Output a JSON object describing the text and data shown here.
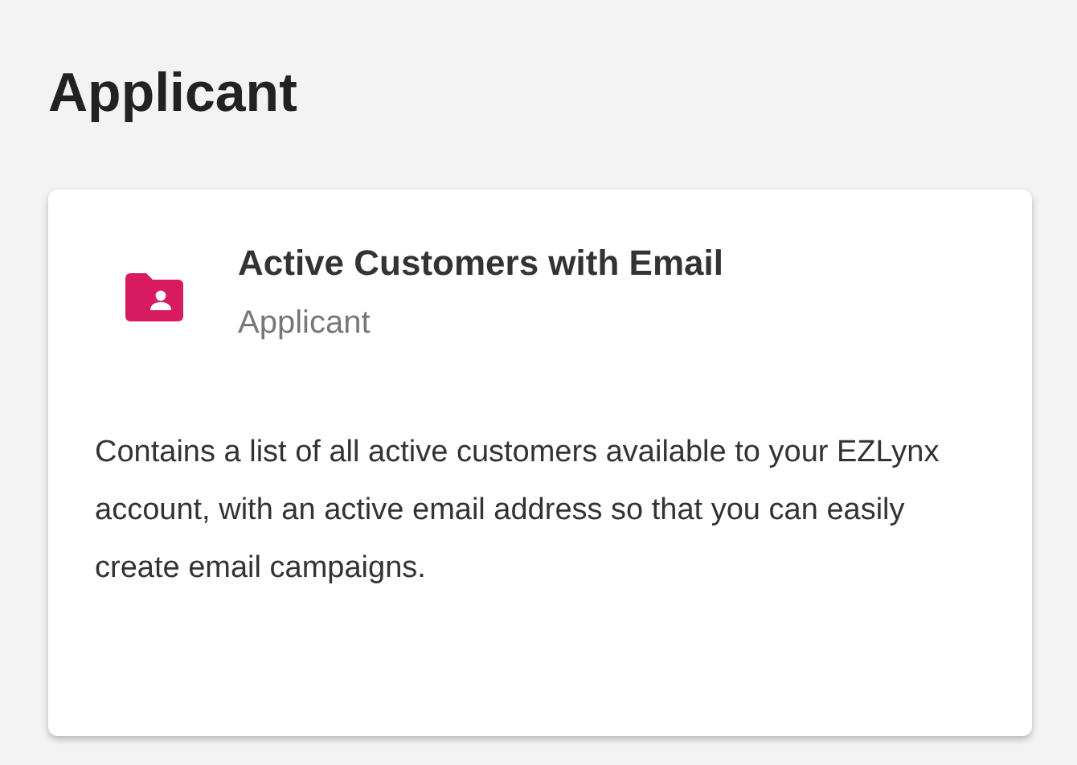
{
  "heading": "Applicant",
  "card": {
    "title": "Active Customers with Email",
    "subtitle": "Applicant",
    "description": "Contains a list of all active customers available to your EZLynx account, with an active email address so that you can easily create email campaigns."
  }
}
